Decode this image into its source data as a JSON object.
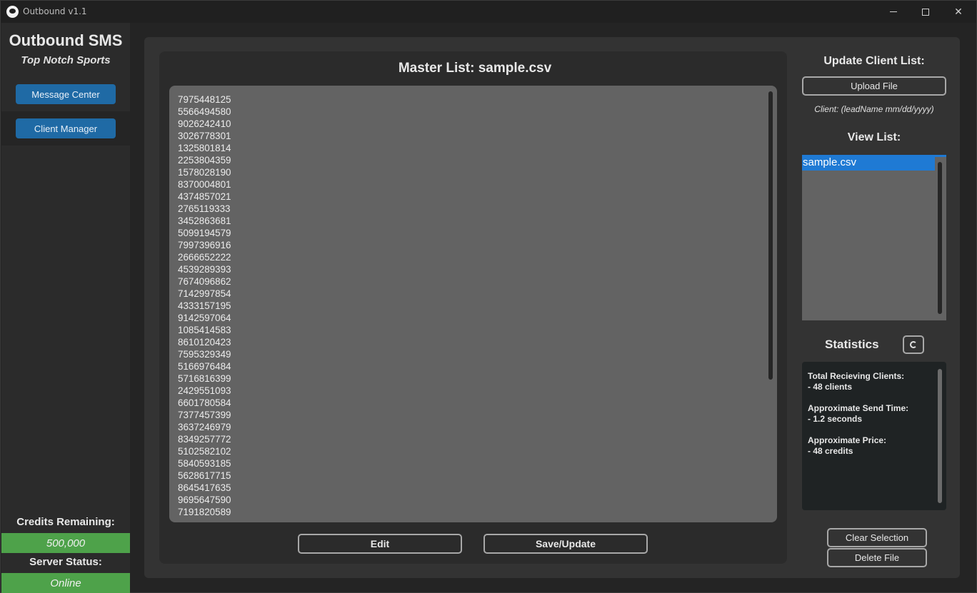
{
  "window": {
    "title": "Outbound v1.1"
  },
  "sidebar": {
    "brand": "Outbound SMS",
    "subtitle": "Top Notch Sports",
    "nav": [
      {
        "label": "Message Center"
      },
      {
        "label": "Client Manager"
      }
    ],
    "credits_label": "Credits Remaining:",
    "credits_value": "500,000",
    "server_label": "Server Status:",
    "server_value": "Online"
  },
  "master": {
    "title": "Master List: sample.csv",
    "numbers": [
      "7975448125",
      "5566494580",
      "9026242410",
      "3026778301",
      "1325801814",
      "2253804359",
      "1578028190",
      "8370004801",
      "4374857021",
      "2765119333",
      "3452863681",
      "5099194579",
      "7997396916",
      "2666652222",
      "4539289393",
      "7674096862",
      "7142997854",
      "4333157195",
      "9142597064",
      "1085414583",
      "8610120423",
      "7595329349",
      "5166976484",
      "5716816399",
      "2429551093",
      "6601780584",
      "7377457399",
      "3637246979",
      "8349257772",
      "5102582102",
      "5840593185",
      "5628617715",
      "8645417635",
      "9695647590",
      "7191820589"
    ],
    "edit_label": "Edit",
    "save_label": "Save/Update"
  },
  "right": {
    "update_title": "Update Client List:",
    "upload_label": "Upload File",
    "hint": "Client: (leadName mm/dd/yyyy)",
    "view_title": "View List:",
    "files": [
      "sample.csv"
    ],
    "stats_title": "Statistics",
    "stats": [
      {
        "label": "Total Recieving Clients:",
        "value": "- 48 clients"
      },
      {
        "label": "Approximate Send Time:",
        "value": "- 1.2 seconds"
      },
      {
        "label": "Approximate Price:",
        "value": "- 48 credits"
      }
    ],
    "clear_label": "Clear Selection",
    "delete_label": "Delete File"
  },
  "colors": {
    "accent": "#1f6aa5",
    "selection": "#1f7ad4",
    "status_green": "#4ea24a"
  }
}
